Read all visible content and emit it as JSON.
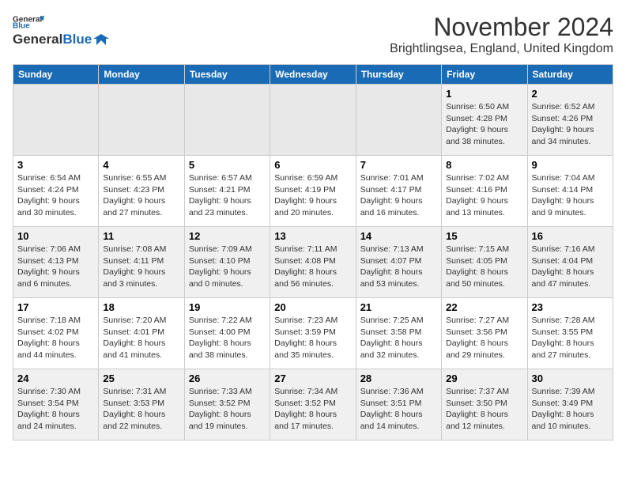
{
  "header": {
    "logo_line1": "General",
    "logo_line2": "Blue",
    "month": "November 2024",
    "location": "Brightlingsea, England, United Kingdom"
  },
  "weekdays": [
    "Sunday",
    "Monday",
    "Tuesday",
    "Wednesday",
    "Thursday",
    "Friday",
    "Saturday"
  ],
  "weeks": [
    [
      {
        "day": "",
        "info": ""
      },
      {
        "day": "",
        "info": ""
      },
      {
        "day": "",
        "info": ""
      },
      {
        "day": "",
        "info": ""
      },
      {
        "day": "",
        "info": ""
      },
      {
        "day": "1",
        "info": "Sunrise: 6:50 AM\nSunset: 4:28 PM\nDaylight: 9 hours\nand 38 minutes."
      },
      {
        "day": "2",
        "info": "Sunrise: 6:52 AM\nSunset: 4:26 PM\nDaylight: 9 hours\nand 34 minutes."
      }
    ],
    [
      {
        "day": "3",
        "info": "Sunrise: 6:54 AM\nSunset: 4:24 PM\nDaylight: 9 hours\nand 30 minutes."
      },
      {
        "day": "4",
        "info": "Sunrise: 6:55 AM\nSunset: 4:23 PM\nDaylight: 9 hours\nand 27 minutes."
      },
      {
        "day": "5",
        "info": "Sunrise: 6:57 AM\nSunset: 4:21 PM\nDaylight: 9 hours\nand 23 minutes."
      },
      {
        "day": "6",
        "info": "Sunrise: 6:59 AM\nSunset: 4:19 PM\nDaylight: 9 hours\nand 20 minutes."
      },
      {
        "day": "7",
        "info": "Sunrise: 7:01 AM\nSunset: 4:17 PM\nDaylight: 9 hours\nand 16 minutes."
      },
      {
        "day": "8",
        "info": "Sunrise: 7:02 AM\nSunset: 4:16 PM\nDaylight: 9 hours\nand 13 minutes."
      },
      {
        "day": "9",
        "info": "Sunrise: 7:04 AM\nSunset: 4:14 PM\nDaylight: 9 hours\nand 9 minutes."
      }
    ],
    [
      {
        "day": "10",
        "info": "Sunrise: 7:06 AM\nSunset: 4:13 PM\nDaylight: 9 hours\nand 6 minutes."
      },
      {
        "day": "11",
        "info": "Sunrise: 7:08 AM\nSunset: 4:11 PM\nDaylight: 9 hours\nand 3 minutes."
      },
      {
        "day": "12",
        "info": "Sunrise: 7:09 AM\nSunset: 4:10 PM\nDaylight: 9 hours\nand 0 minutes."
      },
      {
        "day": "13",
        "info": "Sunrise: 7:11 AM\nSunset: 4:08 PM\nDaylight: 8 hours\nand 56 minutes."
      },
      {
        "day": "14",
        "info": "Sunrise: 7:13 AM\nSunset: 4:07 PM\nDaylight: 8 hours\nand 53 minutes."
      },
      {
        "day": "15",
        "info": "Sunrise: 7:15 AM\nSunset: 4:05 PM\nDaylight: 8 hours\nand 50 minutes."
      },
      {
        "day": "16",
        "info": "Sunrise: 7:16 AM\nSunset: 4:04 PM\nDaylight: 8 hours\nand 47 minutes."
      }
    ],
    [
      {
        "day": "17",
        "info": "Sunrise: 7:18 AM\nSunset: 4:02 PM\nDaylight: 8 hours\nand 44 minutes."
      },
      {
        "day": "18",
        "info": "Sunrise: 7:20 AM\nSunset: 4:01 PM\nDaylight: 8 hours\nand 41 minutes."
      },
      {
        "day": "19",
        "info": "Sunrise: 7:22 AM\nSunset: 4:00 PM\nDaylight: 8 hours\nand 38 minutes."
      },
      {
        "day": "20",
        "info": "Sunrise: 7:23 AM\nSunset: 3:59 PM\nDaylight: 8 hours\nand 35 minutes."
      },
      {
        "day": "21",
        "info": "Sunrise: 7:25 AM\nSunset: 3:58 PM\nDaylight: 8 hours\nand 32 minutes."
      },
      {
        "day": "22",
        "info": "Sunrise: 7:27 AM\nSunset: 3:56 PM\nDaylight: 8 hours\nand 29 minutes."
      },
      {
        "day": "23",
        "info": "Sunrise: 7:28 AM\nSunset: 3:55 PM\nDaylight: 8 hours\nand 27 minutes."
      }
    ],
    [
      {
        "day": "24",
        "info": "Sunrise: 7:30 AM\nSunset: 3:54 PM\nDaylight: 8 hours\nand 24 minutes."
      },
      {
        "day": "25",
        "info": "Sunrise: 7:31 AM\nSunset: 3:53 PM\nDaylight: 8 hours\nand 22 minutes."
      },
      {
        "day": "26",
        "info": "Sunrise: 7:33 AM\nSunset: 3:52 PM\nDaylight: 8 hours\nand 19 minutes."
      },
      {
        "day": "27",
        "info": "Sunrise: 7:34 AM\nSunset: 3:52 PM\nDaylight: 8 hours\nand 17 minutes."
      },
      {
        "day": "28",
        "info": "Sunrise: 7:36 AM\nSunset: 3:51 PM\nDaylight: 8 hours\nand 14 minutes."
      },
      {
        "day": "29",
        "info": "Sunrise: 7:37 AM\nSunset: 3:50 PM\nDaylight: 8 hours\nand 12 minutes."
      },
      {
        "day": "30",
        "info": "Sunrise: 7:39 AM\nSunset: 3:49 PM\nDaylight: 8 hours\nand 10 minutes."
      }
    ]
  ]
}
